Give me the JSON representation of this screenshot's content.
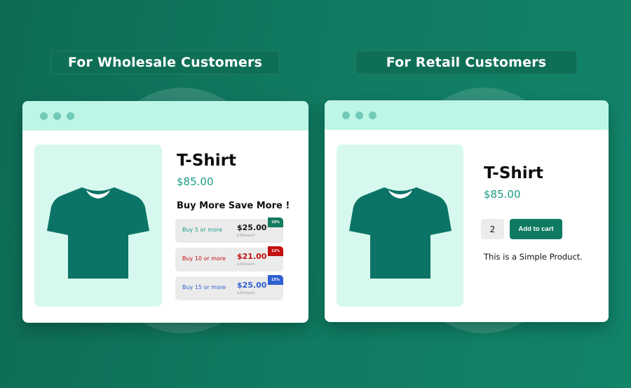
{
  "colors": {
    "background_start": "#0e6b55",
    "background_end": "#11846a",
    "window_bar": "#bdf5e6",
    "window_dots": "#72c9b7",
    "image_bg": "#d6f8ee",
    "shirt": "#0c7466",
    "price": "#1a9c86",
    "button": "#0f7a62"
  },
  "wholesale": {
    "heading": "For Wholesale Customers",
    "product": {
      "image_icon": "t-shirt-icon",
      "title": "T-Shirt",
      "price": "$85.00",
      "promo_heading": "Buy More Save More !",
      "tiers": [
        {
          "label": "Buy 5 or more",
          "price": "$25.00",
          "was": "$30/each",
          "badge": "10%",
          "color": "#1a9c86",
          "badge_color": "#137a5e",
          "price_color": "#111111"
        },
        {
          "label": "Buy 10 or more",
          "price": "$21.00",
          "was": "$30/each",
          "badge": "12%",
          "color": "#c20f0f",
          "badge_color": "#c20f0f",
          "price_color": "#c20f0f"
        },
        {
          "label": "Buy 15 or more",
          "price": "$25.00",
          "was": "$30/each",
          "badge": "15%",
          "color": "#2e5fd1",
          "badge_color": "#2e5fd1",
          "price_color": "#2e5fd1"
        }
      ]
    }
  },
  "retail": {
    "heading": "For Retail Customers",
    "product": {
      "image_icon": "t-shirt-icon",
      "title": "T-Shirt",
      "price": "$85.00",
      "quantity": "2",
      "add_to_cart_label": "Add to cart",
      "description": "This is a Simple Product."
    }
  }
}
